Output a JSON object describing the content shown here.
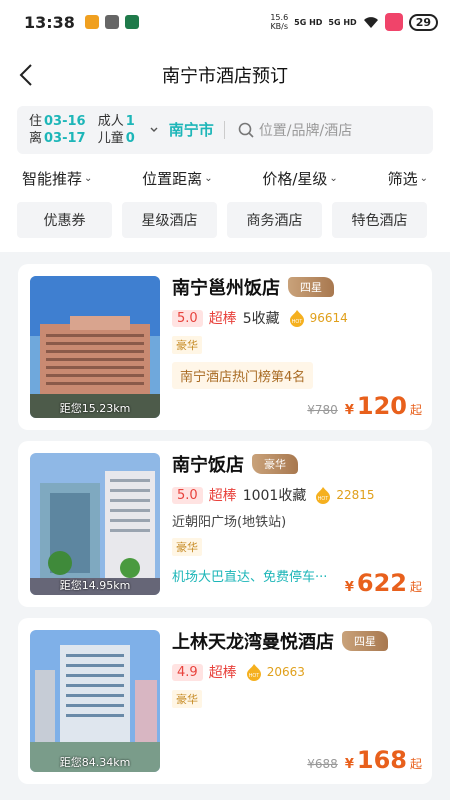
{
  "status": {
    "time": "13:38",
    "net_speed": "15.6",
    "net_unit": "KB/s",
    "sim1": "5G HD",
    "sim2": "5G HD",
    "battery": "29"
  },
  "header": {
    "title": "南宁市酒店预订"
  },
  "search": {
    "checkin_label": "住",
    "checkin_date": "03-16",
    "checkout_label": "离",
    "checkout_date": "03-17",
    "adults_label": "成人",
    "adults": "1",
    "children_label": "儿童",
    "children": "0",
    "city": "南宁市",
    "placeholder": "位置/品牌/酒店"
  },
  "sort": [
    {
      "label": "智能推荐"
    },
    {
      "label": "位置距离"
    },
    {
      "label": "价格/星级"
    },
    {
      "label": "筛选"
    }
  ],
  "tags": [
    {
      "label": "优惠券"
    },
    {
      "label": "星级酒店"
    },
    {
      "label": "商务酒店"
    },
    {
      "label": "特色酒店"
    }
  ],
  "hotels": [
    {
      "name": "南宁邕州饭店",
      "level": "四星",
      "score": "5.0",
      "score_text": "超棒",
      "favorites": "5收藏",
      "hot": "96614",
      "tag": "豪华",
      "rank": "南宁酒店热门榜第4名",
      "distance": "距您15.23km",
      "old_price": "¥780",
      "yen": "¥",
      "price": "120",
      "suffix": "起"
    },
    {
      "name": "南宁饭店",
      "level": "豪华",
      "score": "5.0",
      "score_text": "超棒",
      "favorites": "1001收藏",
      "hot": "22815",
      "address": "近朝阳广场(地铁站)",
      "tag": "豪华",
      "perk": "机场大巴直达、免费停车···",
      "distance": "距您14.95km",
      "yen": "¥",
      "price": "622",
      "suffix": "起"
    },
    {
      "name": "上林天龙湾曼悦酒店",
      "level": "四星",
      "score": "4.9",
      "score_text": "超棒",
      "hot": "20663",
      "tag": "豪华",
      "distance": "距您84.34km",
      "old_price": "¥688",
      "yen": "¥",
      "price": "168",
      "suffix": "起"
    }
  ],
  "colors": {
    "accent": "#1db6b8",
    "price": "#e8601c",
    "score": "#e8433d"
  }
}
